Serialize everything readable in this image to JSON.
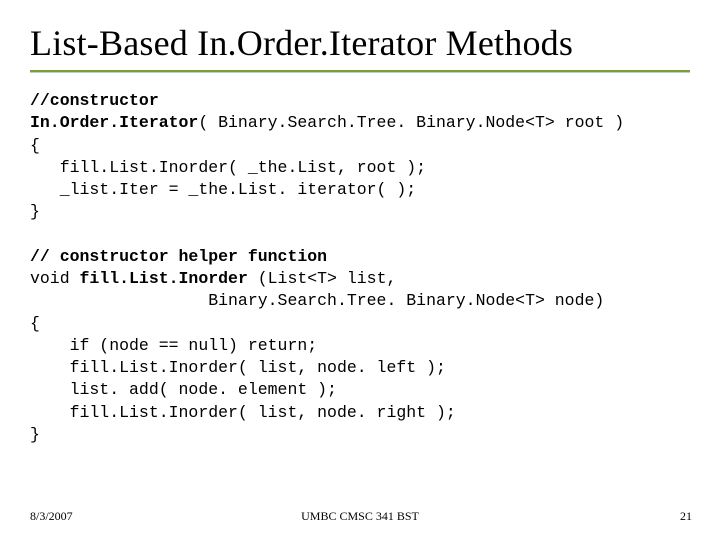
{
  "title": "List-Based In.Order.Iterator Methods",
  "code": {
    "c1": "//constructor",
    "c2a": "In.Order.Iterator",
    "c2b": "( Binary.Search.Tree. Binary.Node<T> root )",
    "c3": "{",
    "c4": "   fill.List.Inorder( _the.List, root );",
    "c5": "   _list.Iter = _the.List. iterator( );",
    "c6": "}",
    "blank1": "",
    "c7": "// constructor helper function",
    "c8a": "void ",
    "c8b": "fill.List.Inorder",
    "c8c": " (List<T> list,",
    "c9": "                  Binary.Search.Tree. Binary.Node<T> node)",
    "c10": "{",
    "c11": "    if (node == null) return;",
    "c12": "    fill.List.Inorder( list, node. left );",
    "c13": "    list. add( node. element );",
    "c14": "    fill.List.Inorder( list, node. right );",
    "c15": "}"
  },
  "footer": {
    "date": "8/3/2007",
    "center": "UMBC CMSC 341 BST",
    "page": "21"
  }
}
